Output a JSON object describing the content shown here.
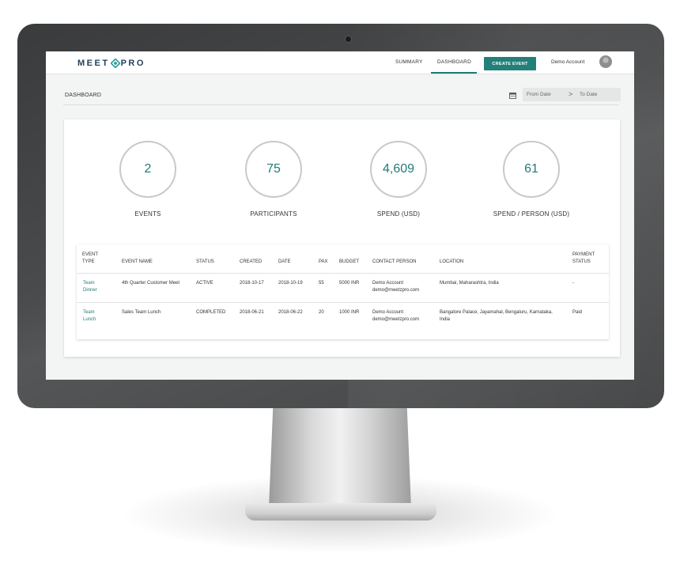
{
  "app": {
    "logo_left": "MEET",
    "logo_right": "PRO"
  },
  "nav": {
    "summary": "SUMMARY",
    "dashboard": "DASHBOARD",
    "create_event": "CREATE EVENT",
    "account_name": "Demo Account"
  },
  "page": {
    "title": "DASHBOARD",
    "from_date_placeholder": "From Date",
    "arrow": ">",
    "to_date_placeholder": "To Date"
  },
  "stats": [
    {
      "value": "2",
      "label": "EVENTS"
    },
    {
      "value": "75",
      "label": "PARTICIPANTS"
    },
    {
      "value": "4,609",
      "label": "SPEND (USD)"
    },
    {
      "value": "61",
      "label": "SPEND / PERSON (USD)"
    }
  ],
  "table": {
    "headers": {
      "event_type": "EVENT TYPE",
      "event_name": "EVENT NAME",
      "status": "STATUS",
      "created": "CREATED",
      "date": "DATE",
      "pax": "PAX",
      "budget": "BUDGET",
      "contact_person": "CONTACT PERSON",
      "location": "LOCATION",
      "payment_status": "PAYMENT STATUS"
    },
    "rows": [
      {
        "event_type": "Team Dinner",
        "event_name": "4th Quarter Customer Meet",
        "status": "ACTIVE",
        "created": "2018-10-17",
        "date": "2018-10-19",
        "pax": "55",
        "budget": "5000 INR",
        "contact_name": "Demo Account",
        "contact_email": "demo@meetzpro.com",
        "location": "Mumbai, Maharashtra, India",
        "payment_status": "-"
      },
      {
        "event_type": "Team Lunch",
        "event_name": "Sales Team Lunch",
        "status": "COMPLETED",
        "created": "2018-06-21",
        "date": "2018-06-22",
        "pax": "20",
        "budget": "1000 INR",
        "contact_name": "Demo Account",
        "contact_email": "demo@meetzpro.com",
        "location": "Bangalore Palace, Jayamahal, Bengaluru, Karnataka, India",
        "payment_status": "Paid"
      }
    ]
  },
  "colors": {
    "accent": "#237f7a",
    "logo": "#1f3f5c",
    "bezel": "#404142"
  }
}
